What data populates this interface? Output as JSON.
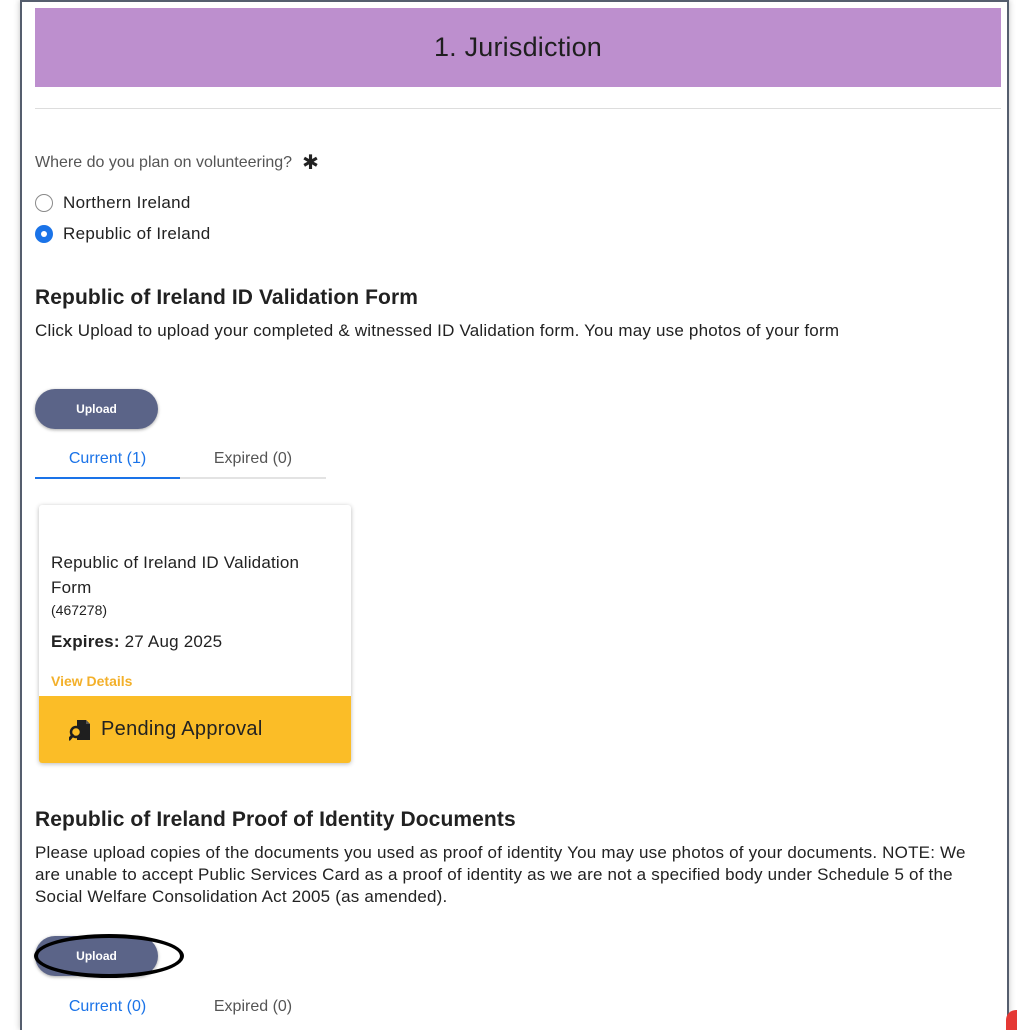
{
  "header": {
    "title": "1. Jurisdiction"
  },
  "jurisdiction": {
    "question": "Where do you plan on volunteering?",
    "required_mark": "✱",
    "options": [
      {
        "label": "Northern Ireland",
        "selected": false
      },
      {
        "label": "Republic of Ireland",
        "selected": true
      }
    ]
  },
  "id_validation": {
    "title": "Republic of Ireland ID Validation Form",
    "description": "Click Upload to upload your completed & witnessed ID Validation form. You may use photos of your form",
    "upload_label": "Upload",
    "tabs": [
      {
        "label": "Current (1)",
        "active": true
      },
      {
        "label": "Expired (0)",
        "active": false
      }
    ],
    "card": {
      "title": "Republic of Ireland ID Validation Form",
      "id": "(467278)",
      "expires_label": "Expires:",
      "expires_value": "27 Aug 2025",
      "link": "View Details",
      "status": "Pending Approval",
      "status_icon": "document-search-icon",
      "status_color": "#fbbd27"
    }
  },
  "proof_of_identity": {
    "title": "Republic of Ireland Proof of Identity Documents",
    "description": "Please upload copies of the documents you used as proof of identity You may use photos of your documents. NOTE: We are unable to accept Public Services Card as a proof of identity as we are not a specified body under Schedule 5 of the Social Welfare Consolidation Act 2005 (as amended).",
    "upload_label": "Upload",
    "tabs": [
      {
        "label": "Current (0)",
        "active": true
      },
      {
        "label": "Expired (0)",
        "active": false
      }
    ]
  },
  "colors": {
    "header_bg": "#bd8fce",
    "accent_blue": "#1a73e8",
    "upload_button": "#5b6488",
    "link_yellow": "#f3b02a"
  }
}
